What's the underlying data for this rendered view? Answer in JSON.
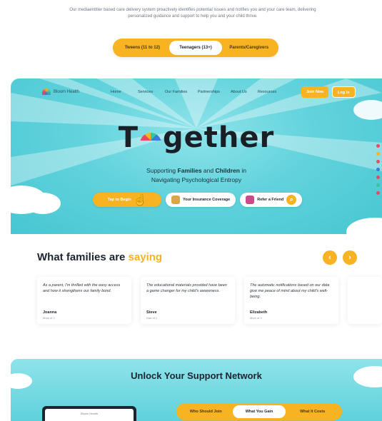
{
  "intro": {
    "text": "Our mediaentitier based care delivery system proactively identifies potential issues and notifies you and your care team, delivering personalized guidance and support to help you and your child thrive."
  },
  "age_toggle": {
    "options": [
      "Tweens (11 to 12)",
      "Teenagers (13+)",
      "Parents/Caregivers"
    ],
    "active_index": 1
  },
  "nav": {
    "logo_text": "Bloom Health",
    "links": [
      "Home",
      "Services",
      "Our Families",
      "Partnerships",
      "About Us",
      "Resources"
    ],
    "join_label": "Join Now",
    "login_label": "Log in"
  },
  "hero": {
    "title_left": "T",
    "title_right": "gether",
    "subtitle_1": "Supporting ",
    "subtitle_families": "Families",
    "subtitle_and": " and ",
    "subtitle_children": "Children",
    "subtitle_2": " in",
    "subtitle_line2": "Navigating Psychological Entropy",
    "cta_label": "Tap to Begin",
    "insurance_label": "Your Insurance Coverage",
    "refer_label": "Refer a Friend"
  },
  "side_dots": [
    "#e84a5f",
    "#f7b321",
    "#e84a5f",
    "#3a7bd5",
    "#e84a5f",
    "#36c3a0",
    "#e84a5f"
  ],
  "testimonials": {
    "title_prefix": "What families are ",
    "title_highlight": "saying",
    "cards": [
      {
        "quote": "As a parent, I'm thrilled with the easy access and how it strengthens our family bond.",
        "name": "Joanna",
        "role": "Mom of 2"
      },
      {
        "quote": "The educational materials provided have been a game changer for my child's awareness.",
        "name": "Steve",
        "role": "Dad of 1"
      },
      {
        "quote": "The automatic notifications based on our data give me peace of mind about my child's well-being.",
        "name": "Elizabeth",
        "role": "Mom of 3"
      }
    ],
    "prev_icon": "chevron-left-icon",
    "next_icon": "chevron-right-icon"
  },
  "support": {
    "title": "Unlock Your Support Network",
    "tabs": [
      "Who Should Join",
      "What You Gain",
      "What It Costs"
    ],
    "active_index": 1,
    "device_screen_text": "Bloom Health"
  },
  "colors": {
    "accent": "#f7b321",
    "hero_bg": "#5fd1db",
    "text_dark": "#1c2430"
  }
}
